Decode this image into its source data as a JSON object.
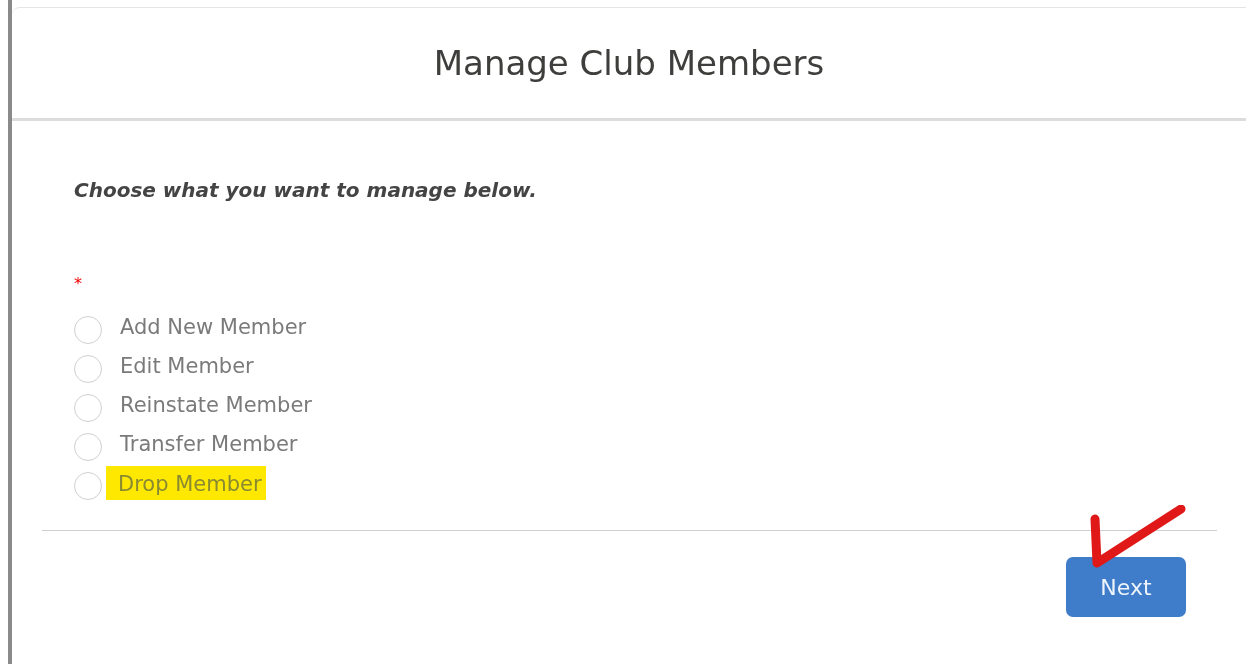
{
  "modal": {
    "title": "Manage Club Members"
  },
  "instruction": "Choose what you want to manage below.",
  "required_mark": "*",
  "options": [
    {
      "label": "Add New Member",
      "selected": false,
      "highlighted": false
    },
    {
      "label": "Edit Member",
      "selected": false,
      "highlighted": false
    },
    {
      "label": "Reinstate Member",
      "selected": false,
      "highlighted": false
    },
    {
      "label": "Transfer Member",
      "selected": false,
      "highlighted": false
    },
    {
      "label": "Drop Member",
      "selected": false,
      "highlighted": true
    }
  ],
  "next_button": {
    "label": "Next",
    "check_mark": true
  }
}
